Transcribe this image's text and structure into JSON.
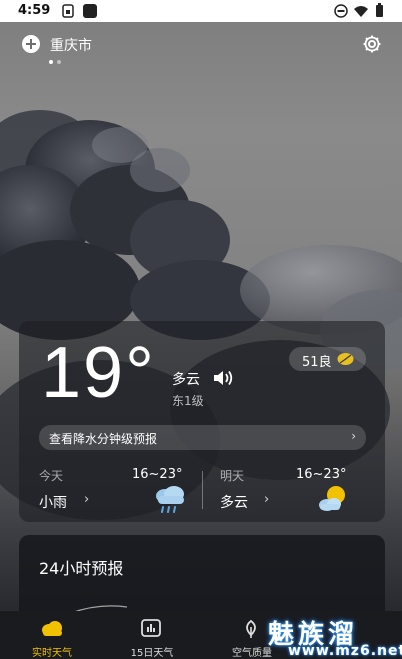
{
  "status_bar": {
    "time": "4:59"
  },
  "header": {
    "city": "重庆市",
    "page_dots": 2,
    "active_dot": 0
  },
  "current": {
    "temperature": "19°",
    "condition": "多云",
    "wind": "东1级",
    "aqi": "51良",
    "precip_link": "查看降水分钟级预报",
    "precip_arrow": "›"
  },
  "forecast": [
    {
      "day": "今天",
      "condition": "小雨",
      "range": "16~23°",
      "arrow": "›",
      "icon": "rain-cloud-icon"
    },
    {
      "day": "明天",
      "condition": "多云",
      "range": "16~23°",
      "arrow": "›",
      "icon": "sun-cloud-icon"
    }
  ],
  "hourly": {
    "title": "24小时预报"
  },
  "nav": [
    {
      "label": "实时天气",
      "icon": "cloud-icon",
      "active": true
    },
    {
      "label": "15日天气",
      "icon": "chart-icon",
      "active": false
    },
    {
      "label": "空气质量",
      "icon": "leaf-icon",
      "active": false
    }
  ],
  "watermark": {
    "title": "魅族溜",
    "url": "www.mz6.net"
  },
  "colors": {
    "accent": "#f2c200",
    "aqi_leaf": "#e8c020",
    "watermark_glow": "#3aa7ff"
  }
}
